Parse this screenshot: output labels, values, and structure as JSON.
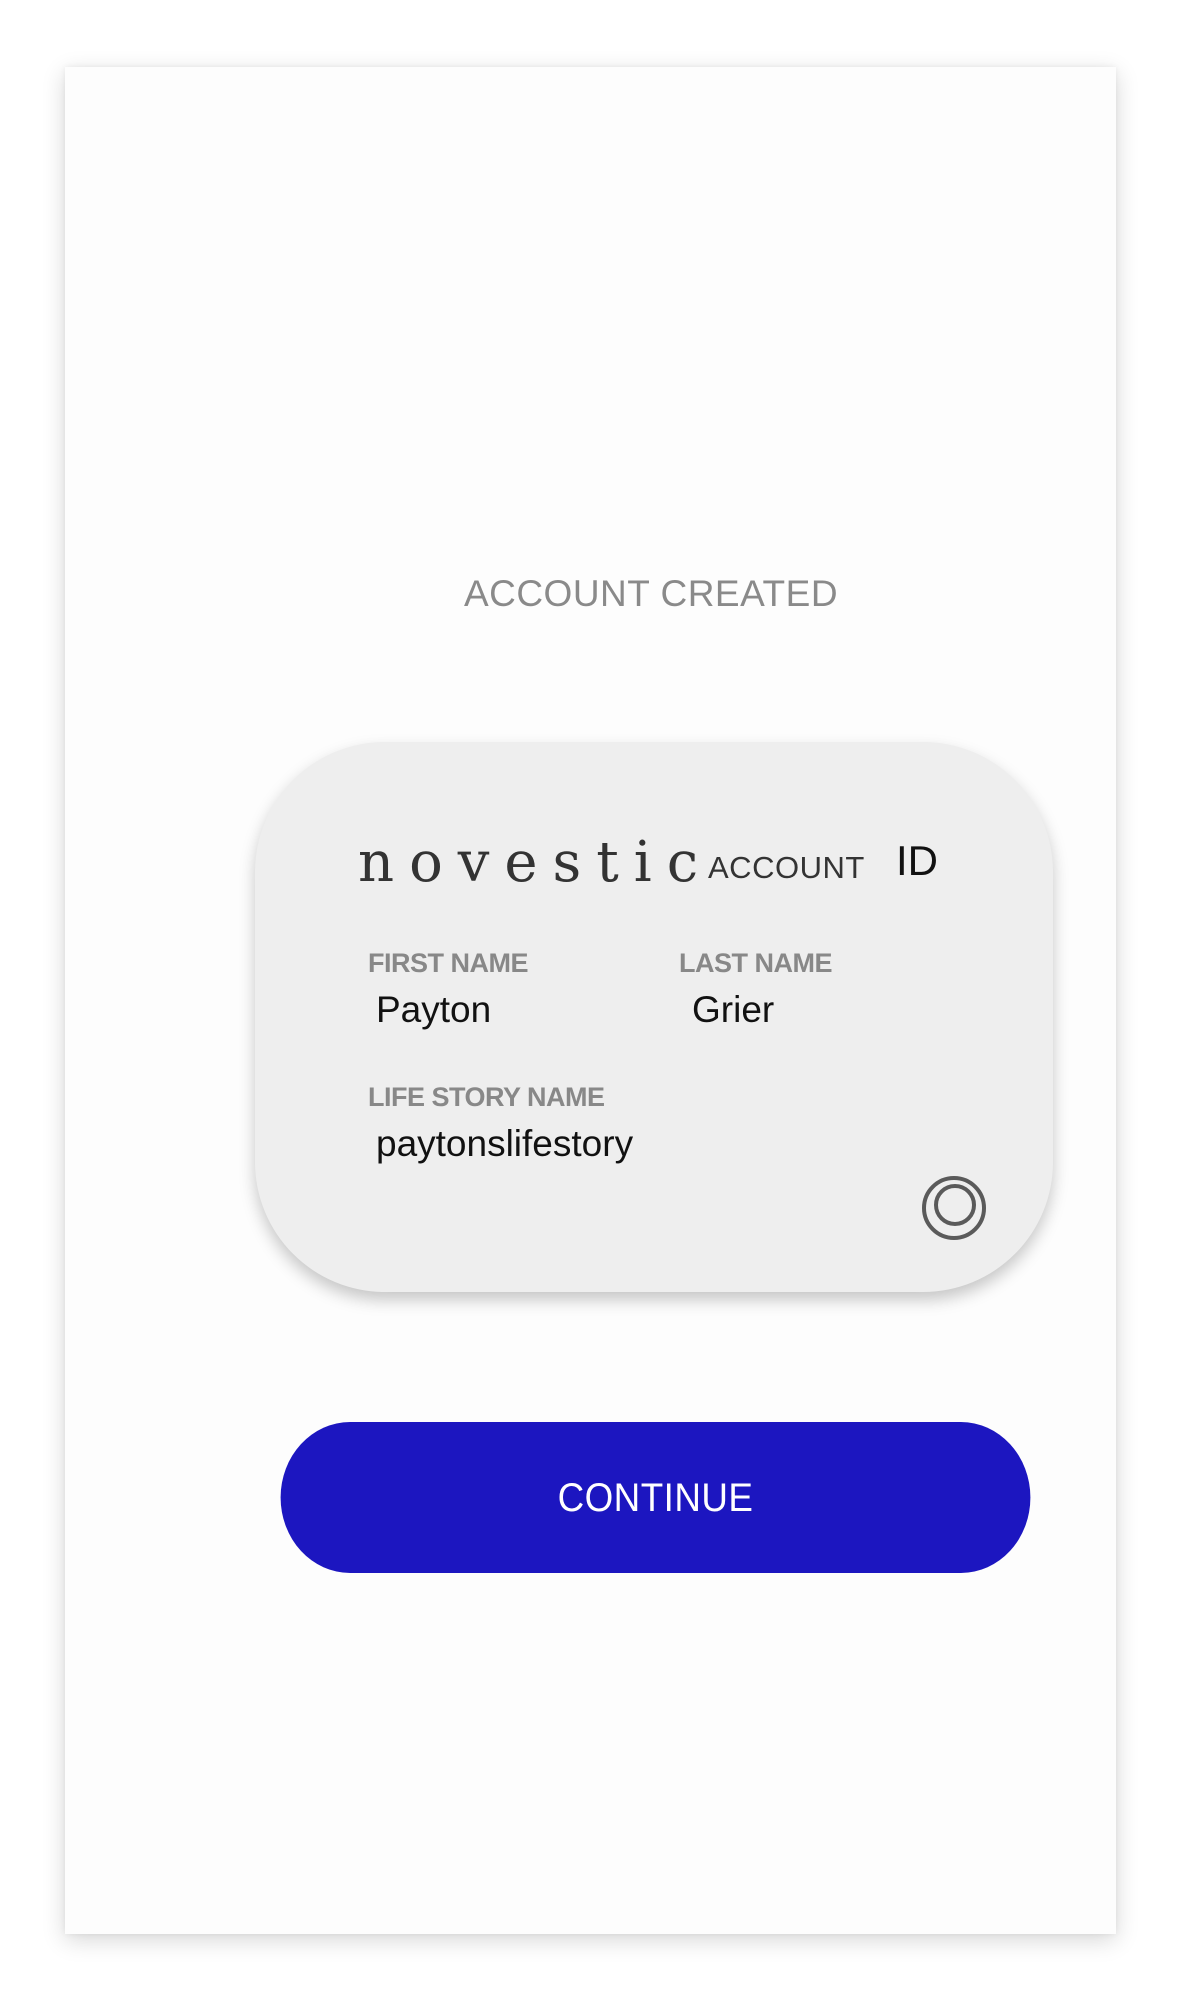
{
  "screen": {
    "heading": "ACCOUNT CREATED"
  },
  "card": {
    "brand": "novestic",
    "account_label": "ACCOUNT",
    "id_label": "ID",
    "first_name_label": "FIRST NAME",
    "first_name_value": "Payton",
    "last_name_label": "LAST NAME",
    "last_name_value": "Grier",
    "life_story_label": "LIFE STORY NAME",
    "life_story_value": "paytonslifestory",
    "logo_icon": "concentric-circles-icon"
  },
  "actions": {
    "continue_label": "CONTINUE"
  },
  "colors": {
    "accent": "#1c16c0",
    "card_background": "#eeeeee",
    "label_gray": "#888888"
  }
}
